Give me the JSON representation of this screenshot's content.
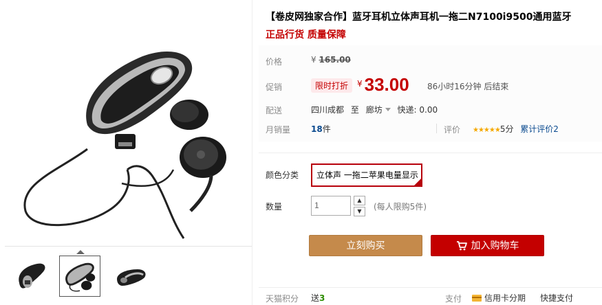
{
  "product": {
    "title": "【卷皮网独家合作】蓝牙耳机立体声耳机一拖二N7100i9500通用蓝牙",
    "subtitle": "正品行货 质量保障"
  },
  "labels": {
    "price": "价格",
    "promo": "促销",
    "delivery": "配送",
    "monthly_sales": "月销量",
    "rating": "评价",
    "color": "颜色分类",
    "quantity": "数量",
    "tmall_points": "天猫积分",
    "payment": "支付"
  },
  "pricing": {
    "currency": "¥",
    "original": "165.00",
    "promo_badge": "限时打折",
    "current": "33.00",
    "countdown": "86小时16分钟 后结束"
  },
  "delivery": {
    "from": "四川成都",
    "to_word": "至",
    "to": "廊坊",
    "shipping": "快递: 0.00"
  },
  "sales": {
    "count": "18",
    "unit": "件"
  },
  "rating": {
    "stars": "★★★★★",
    "score": "5分",
    "reviews": "累计评价2"
  },
  "options": {
    "color_selected": "立体声 一拖二苹果电量显示"
  },
  "quantity": {
    "value": "1",
    "limit": "(每人限购5件)"
  },
  "buttons": {
    "buy_now": "立刻购买",
    "add_to_cart": "加入购物车"
  },
  "footer": {
    "points_prefix": "送",
    "points_value": "3",
    "credit_card": "信用卡分期",
    "quick_pay": "快捷支付"
  },
  "colors": {
    "accent_red": "#c40000",
    "buy_gold": "#c58a4b"
  }
}
